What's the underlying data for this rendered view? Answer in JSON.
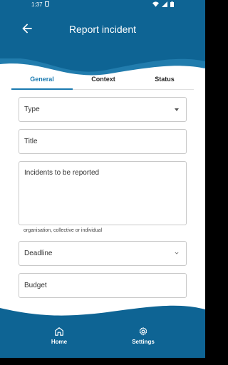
{
  "status_bar": {
    "time": "1:37"
  },
  "app_bar": {
    "title": "Report incident"
  },
  "tabs": [
    {
      "label": "General",
      "active": true
    },
    {
      "label": "Context",
      "active": false
    },
    {
      "label": "Status",
      "active": false
    }
  ],
  "form": {
    "type_placeholder": "Type",
    "title_placeholder": "Title",
    "incidents_placeholder": "Incidents to be reported",
    "incidents_helper": "organisation, collective or individual",
    "deadline_placeholder": "Deadline",
    "budget_placeholder": "Budget"
  },
  "bottom_nav": {
    "home_label": "Home",
    "settings_label": "Settings"
  },
  "colors": {
    "primary": "#0e6494",
    "accent": "#1a7ab0",
    "wave": "#2a86b8"
  }
}
